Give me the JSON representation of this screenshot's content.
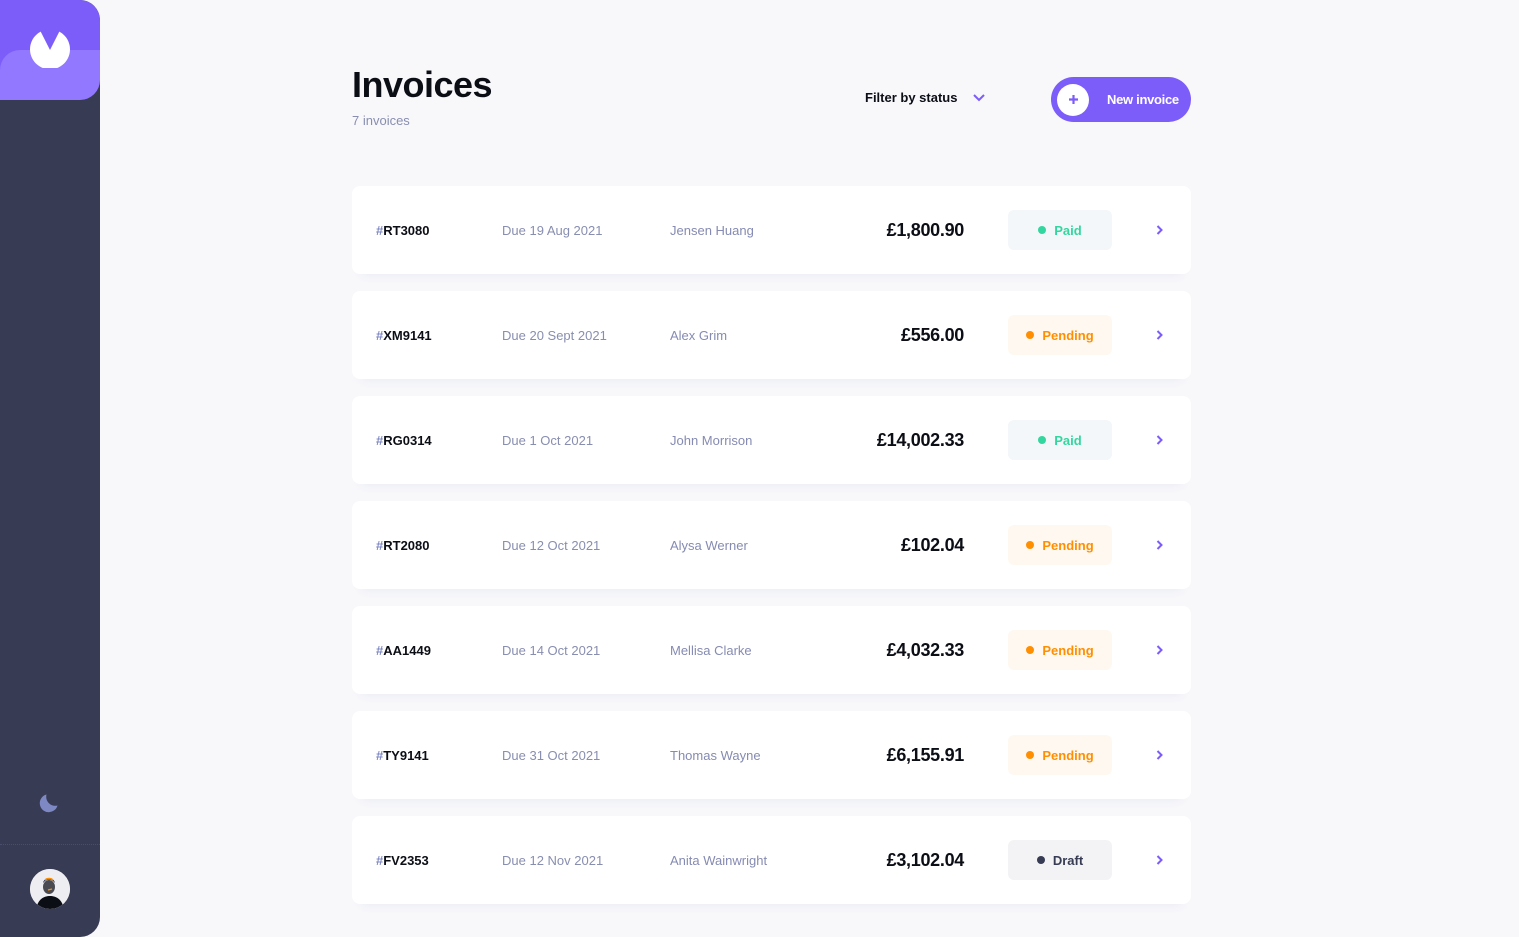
{
  "app": {
    "logo_icon": "app-logo-icon",
    "theme_toggle_icon": "moon-icon",
    "avatar": "user-avatar"
  },
  "colors": {
    "accent": "#7c5dfa",
    "accent_light": "#9277ff",
    "sidebar": "#373b53",
    "paid": "#33d69f",
    "pending": "#ff8f00",
    "draft": "#373b53"
  },
  "header": {
    "title": "Invoices",
    "subtitle": "7 invoices",
    "filter_label": "Filter by status",
    "filter_icon": "chevron-down-icon",
    "new_invoice_label": "New invoice",
    "new_invoice_icon": "plus-icon"
  },
  "invoices": [
    {
      "hash": "#",
      "id": "RT3080",
      "due": "Due 19 Aug 2021",
      "client": "Jensen Huang",
      "amount": "£1,800.90",
      "status": "Paid",
      "status_key": "paid"
    },
    {
      "hash": "#",
      "id": "XM9141",
      "due": "Due 20 Sept 2021",
      "client": "Alex Grim",
      "amount": "£556.00",
      "status": "Pending",
      "status_key": "pending"
    },
    {
      "hash": "#",
      "id": "RG0314",
      "due": "Due 1 Oct 2021",
      "client": "John Morrison",
      "amount": "£14,002.33",
      "status": "Paid",
      "status_key": "paid"
    },
    {
      "hash": "#",
      "id": "RT2080",
      "due": "Due 12 Oct 2021",
      "client": "Alysa Werner",
      "amount": "£102.04",
      "status": "Pending",
      "status_key": "pending"
    },
    {
      "hash": "#",
      "id": "AA1449",
      "due": "Due 14 Oct 2021",
      "client": "Mellisa Clarke",
      "amount": "£4,032.33",
      "status": "Pending",
      "status_key": "pending"
    },
    {
      "hash": "#",
      "id": "TY9141",
      "due": "Due 31 Oct 2021",
      "client": "Thomas Wayne",
      "amount": "£6,155.91",
      "status": "Pending",
      "status_key": "pending"
    },
    {
      "hash": "#",
      "id": "FV2353",
      "due": "Due 12 Nov 2021",
      "client": "Anita Wainwright",
      "amount": "£3,102.04",
      "status": "Draft",
      "status_key": "draft"
    }
  ]
}
